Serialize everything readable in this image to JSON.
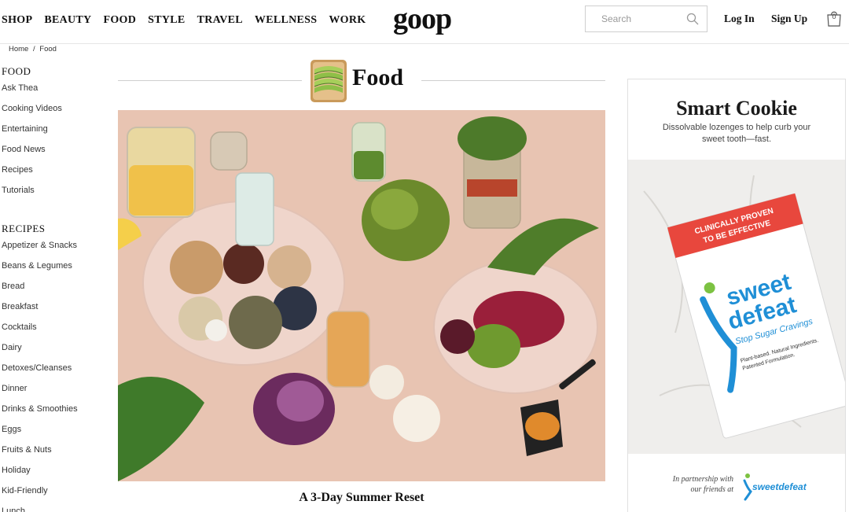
{
  "header": {
    "nav": [
      "SHOP",
      "BEAUTY",
      "FOOD",
      "STYLE",
      "TRAVEL",
      "WELLNESS",
      "WORK"
    ],
    "logo": "goop",
    "search_placeholder": "Search",
    "login": "Log In",
    "signup": "Sign Up",
    "cart_count": "0"
  },
  "breadcrumb": {
    "home": "Home",
    "sep": "/",
    "current": "Food"
  },
  "sidebar": {
    "food_heading": "FOOD",
    "food_items": [
      "Ask Thea",
      "Cooking Videos",
      "Entertaining",
      "Food News",
      "Recipes",
      "Tutorials"
    ],
    "recipes_heading": "RECIPES",
    "recipe_items": [
      "Appetizer & Snacks",
      "Beans & Legumes",
      "Bread",
      "Breakfast",
      "Cocktails",
      "Dairy",
      "Detoxes/Cleanses",
      "Dinner",
      "Drinks & Smoothies",
      "Eggs",
      "Fruits & Nuts",
      "Holiday",
      "Kid-Friendly",
      "Lunch"
    ]
  },
  "main": {
    "title": "Food",
    "hero_caption": "A 3-Day Summer Reset"
  },
  "ad": {
    "title": "Smart Cookie",
    "subtitle": "Dissolvable lozenges to help curb your sweet tooth—fast.",
    "box_banner": "CLINICALLY PROVEN TO BE EFFECTIVE",
    "box_brand_1": "sweet",
    "box_brand_2": "defeat",
    "box_tagline": "Stop Sugar Cravings",
    "box_note": "Plant-based. Natural Ingredients. Patented Formulation.",
    "partner_text": "In partnership with our friends at",
    "partner_brand": "sweetdefeat"
  },
  "colors": {
    "hero_bg": "#e9c5b4",
    "brand_blue": "#1f8fd6",
    "brand_green": "#7cc242",
    "banner_red": "#e8473d"
  }
}
